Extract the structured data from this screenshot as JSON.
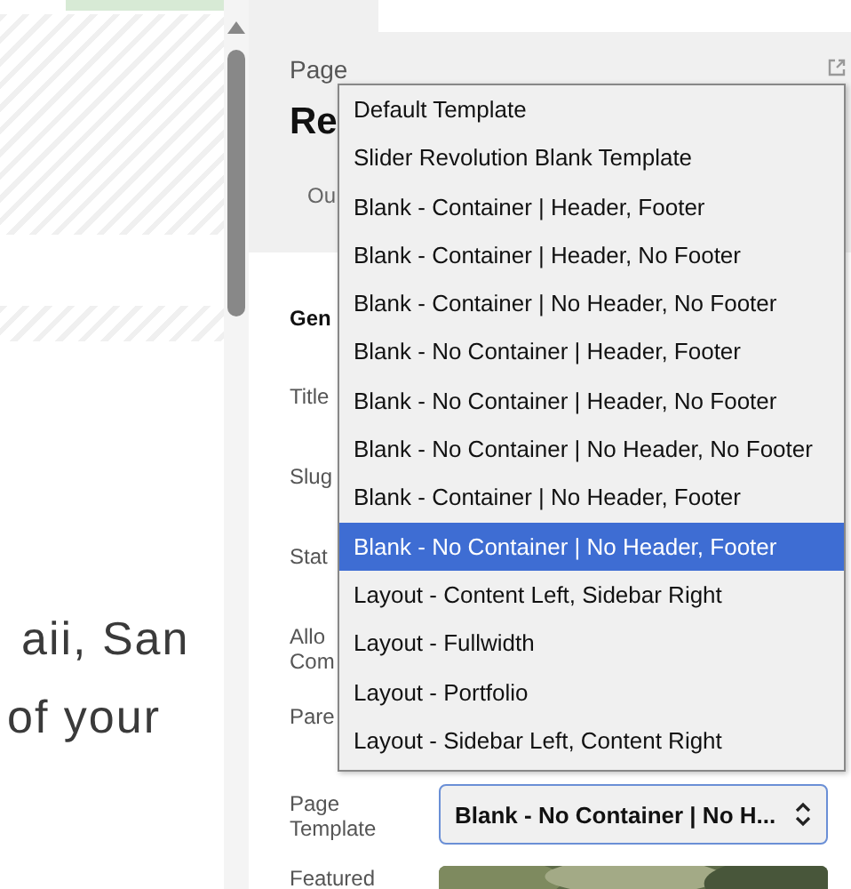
{
  "canvas": {
    "lines": [
      "aii, San",
      "of your"
    ]
  },
  "panel": {
    "kicker": "Page",
    "title": "Re",
    "tab": "Ou",
    "section": "Gen",
    "fields": [
      {
        "label": "Title"
      },
      {
        "label": "Slug"
      },
      {
        "label": "Stat"
      },
      {
        "label": "Allo\nCom"
      },
      {
        "label": "Pare"
      }
    ],
    "template": {
      "label": "Page\nTemplate",
      "value": "Blank - No Container | No H..."
    },
    "featured": {
      "label": "Featured"
    }
  },
  "dropdown": [
    {
      "label": "Default Template",
      "selected": false
    },
    {
      "label": "Slider Revolution Blank Template",
      "selected": false
    },
    {
      "label": "Blank - Container | Header, Footer",
      "selected": false
    },
    {
      "label": "Blank - Container | Header, No Footer",
      "selected": false
    },
    {
      "label": "Blank - Container | No Header, No Footer",
      "selected": false
    },
    {
      "label": "Blank - No Container | Header, Footer",
      "selected": false
    },
    {
      "label": "Blank - No Container | Header, No Footer",
      "selected": false
    },
    {
      "label": "Blank - No Container | No Header, No Footer",
      "selected": false
    },
    {
      "label": "Blank - Container | No Header, Footer",
      "selected": false
    },
    {
      "label": "Blank - No Container | No Header, Footer",
      "selected": true
    },
    {
      "label": "Layout - Content Left, Sidebar Right",
      "selected": false
    },
    {
      "label": "Layout - Fullwidth",
      "selected": false
    },
    {
      "label": "Layout - Portfolio",
      "selected": false
    },
    {
      "label": "Layout - Sidebar Left, Content Right",
      "selected": false
    }
  ]
}
